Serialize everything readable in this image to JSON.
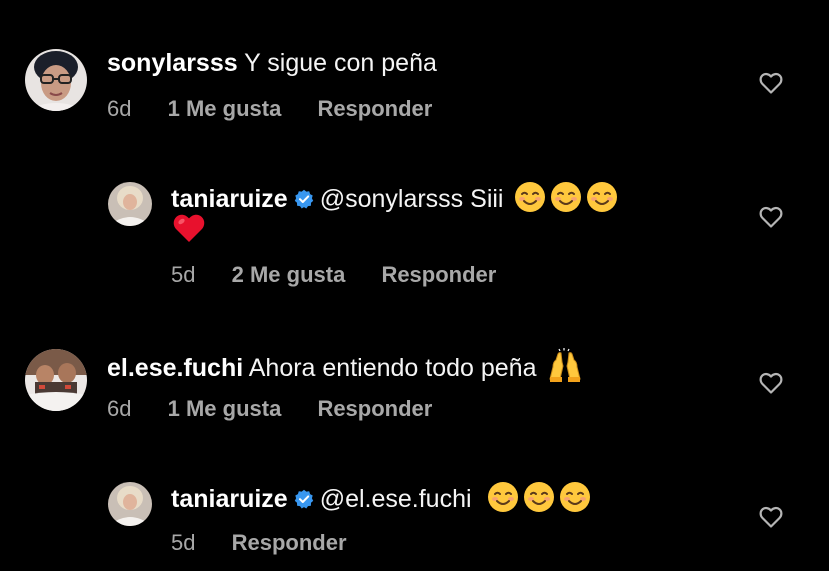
{
  "comments": [
    {
      "username": "sonylarsss",
      "text": "Y sigue con peña",
      "verified": false,
      "time": "6d",
      "likes": "1 Me gusta",
      "reply": "Responder",
      "emojis": []
    },
    {
      "username": "taniaruize",
      "verified": true,
      "mention": "@sonylarsss",
      "text": "Siii",
      "emojis": [
        "smiling-face-emoji",
        "smiling-face-emoji",
        "smiling-face-emoji",
        "red-heart-emoji"
      ],
      "time": "5d",
      "likes": "2 Me gusta",
      "reply": "Responder"
    },
    {
      "username": "el.ese.fuchi",
      "text": "Ahora entiendo todo peña",
      "verified": false,
      "emojis": [
        "raising-hands-emoji"
      ],
      "time": "6d",
      "likes": "1 Me gusta",
      "reply": "Responder"
    },
    {
      "username": "taniaruize",
      "verified": true,
      "mention": "@el.ese.fuchi",
      "text": "",
      "emojis": [
        "smiling-face-emoji",
        "smiling-face-emoji",
        "smiling-face-emoji"
      ],
      "time": "5d",
      "likes": "",
      "reply": "Responder"
    }
  ],
  "colors": {
    "background": "#000000",
    "text": "#ffffff",
    "meta": "#a8a8a8",
    "verified": "#3897f0"
  }
}
